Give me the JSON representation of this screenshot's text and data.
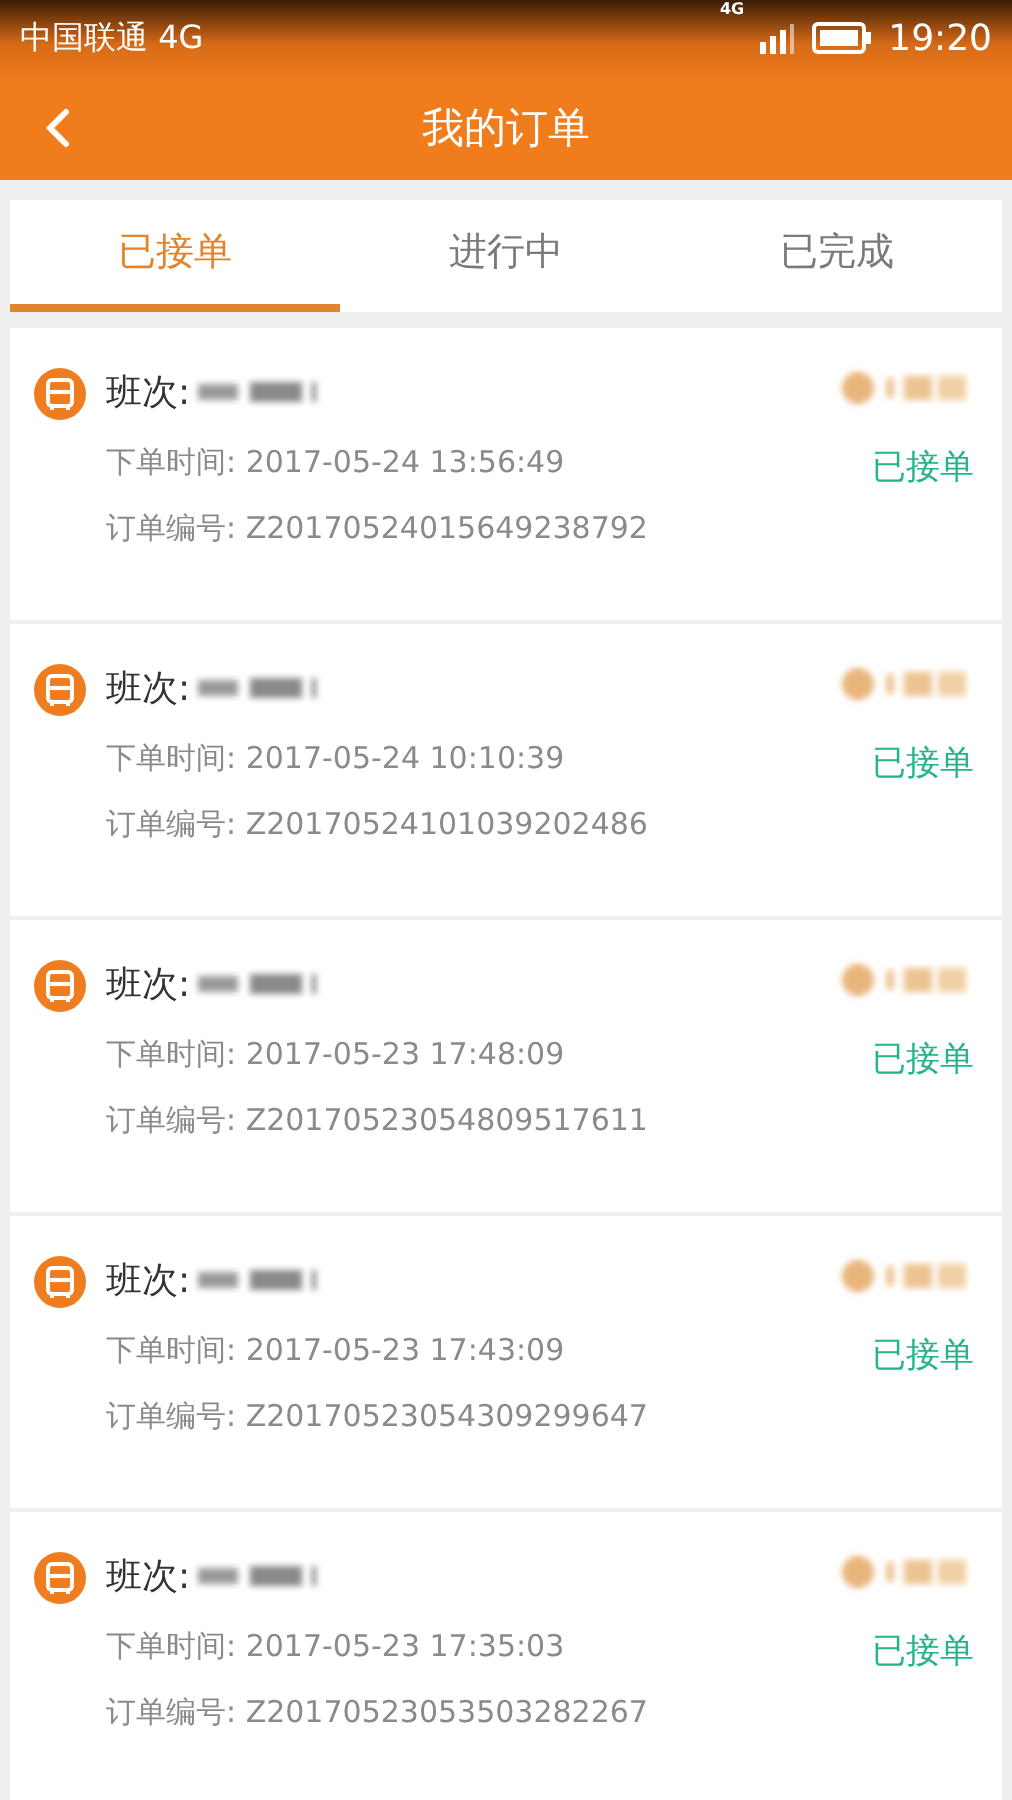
{
  "status_bar": {
    "carrier": "中国联通 4G",
    "network": "4G",
    "time": "19:20"
  },
  "header": {
    "title": "我的订单"
  },
  "tabs": [
    {
      "label": "已接单",
      "selected": true
    },
    {
      "label": "进行中",
      "selected": false
    },
    {
      "label": "已完成",
      "selected": false
    }
  ],
  "orders": [
    {
      "route_label": "班次:",
      "time_label": "下单时间: 2017-05-24 13:56:49",
      "number_label": "订单编号: Z20170524015649238792",
      "status": "已接单"
    },
    {
      "route_label": "班次:",
      "time_label": "下单时间: 2017-05-24 10:10:39",
      "number_label": "订单编号: Z20170524101039202486",
      "status": "已接单"
    },
    {
      "route_label": "班次:",
      "time_label": "下单时间: 2017-05-23 17:48:09",
      "number_label": "订单编号: Z20170523054809517611",
      "status": "已接单"
    },
    {
      "route_label": "班次:",
      "time_label": "下单时间: 2017-05-23 17:43:09",
      "number_label": "订单编号: Z20170523054309299647",
      "status": "已接单"
    },
    {
      "route_label": "班次:",
      "time_label": "下单时间: 2017-05-23 17:35:03",
      "number_label": "订单编号: Z20170523053503282267",
      "status": "已接单"
    }
  ]
}
